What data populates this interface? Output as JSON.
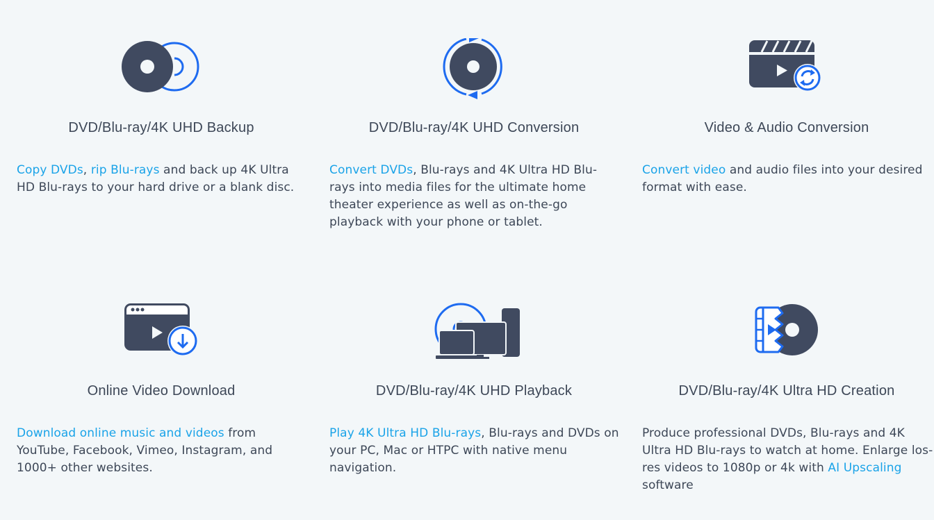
{
  "colors": {
    "background": "#f3f7f9",
    "text": "#3d4757",
    "link": "#1aa3e8",
    "icon_dark": "#404a60",
    "icon_accent": "#1e6bf0"
  },
  "features": [
    {
      "icon": "disc-backup-icon",
      "title": "DVD/Blu-ray/4K UHD Backup",
      "desc": [
        {
          "text": "Copy DVDs",
          "link": true
        },
        {
          "text": ", ",
          "link": false
        },
        {
          "text": "rip Blu-rays",
          "link": true
        },
        {
          "text": " and back up 4K Ultra HD Blu-rays to your hard drive or a blank disc.",
          "link": false
        }
      ]
    },
    {
      "icon": "disc-conversion-icon",
      "title": "DVD/Blu-ray/4K UHD Conversion",
      "desc": [
        {
          "text": "Convert DVDs",
          "link": true
        },
        {
          "text": ", Blu-rays and 4K Ultra HD Blu-rays into media files for the ultimate home theater experience as well as on-the-go playback with your phone or tablet.",
          "link": false
        }
      ]
    },
    {
      "icon": "video-conversion-icon",
      "title": "Video & Audio Conversion",
      "desc": [
        {
          "text": "Convert video",
          "link": true
        },
        {
          "text": " and audio files into your desired format with ease.",
          "link": false
        }
      ]
    },
    {
      "icon": "video-download-icon",
      "title": "Online Video Download",
      "desc": [
        {
          "text": "Download online music and videos",
          "link": true
        },
        {
          "text": " from YouTube, Facebook, Vimeo, Instagram, and 1000+ other websites.",
          "link": false
        }
      ]
    },
    {
      "icon": "disc-playback-icon",
      "title": "DVD/Blu-ray/4K UHD Playback",
      "desc": [
        {
          "text": "Play 4K Ultra HD Blu-rays",
          "link": true
        },
        {
          "text": ", Blu-rays and DVDs on your PC, Mac or HTPC with native menu navigation.",
          "link": false
        }
      ]
    },
    {
      "icon": "disc-creation-icon",
      "title": "DVD/Blu-ray/4K Ultra HD Creation",
      "desc": [
        {
          "text": "Produce professional DVDs, Blu-rays and 4K Ultra HD Blu-rays to watch at home. Enlarge los-res videos to 1080p or 4k with ",
          "link": false
        },
        {
          "text": "AI Upscaling",
          "link": true
        },
        {
          "text": " software",
          "link": false
        }
      ]
    }
  ]
}
